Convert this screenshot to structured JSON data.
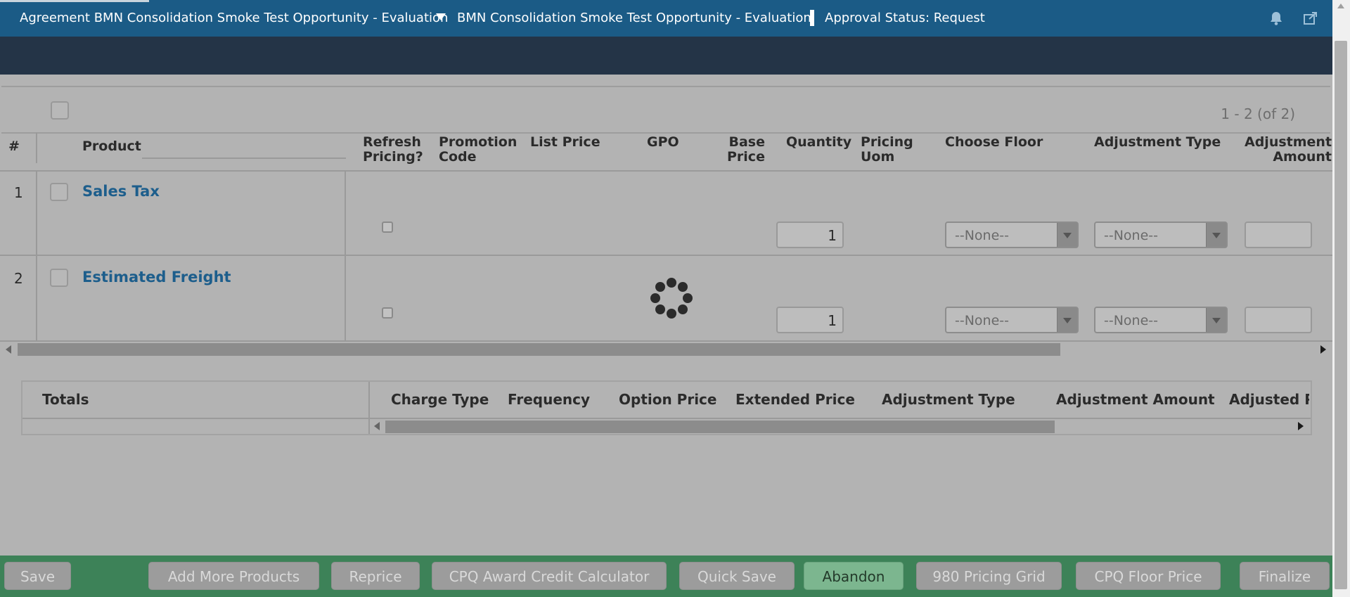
{
  "header": {
    "agreement_crumb": "Agreement BMN Consolidation Smoke Test Opportunity - Evaluation",
    "opportunity_crumb": "BMN Consolidation Smoke Test Opportunity - Evaluation",
    "approval_status": "Approval Status: Request",
    "icons": [
      "bell-icon",
      "share-icon",
      "chevron-down-icon"
    ]
  },
  "grid": {
    "pager": "1 - 2 (of 2)",
    "columns": {
      "num": "#",
      "product": "Product",
      "refresh1": "Refresh",
      "refresh2": "Pricing?",
      "promo1": "Promotion",
      "promo2": "Code",
      "list_price": "List Price",
      "gpo": "GPO",
      "base1": "Base",
      "base2": "Price",
      "quantity": "Quantity",
      "uom1": "Pricing",
      "uom2": "Uom",
      "choose_floor": "Choose Floor",
      "adjustment_type": "Adjustment Type",
      "adjamt1": "Adjustment",
      "adjamt2": "Amount"
    },
    "rows": [
      {
        "num": "1",
        "product": "Sales Tax",
        "quantity": "1",
        "choose_floor": "--None--",
        "adjustment_type": "--None--"
      },
      {
        "num": "2",
        "product": "Estimated Freight",
        "quantity": "1",
        "choose_floor": "--None--",
        "adjustment_type": "--None--"
      }
    ]
  },
  "totals": {
    "label": "Totals",
    "columns": [
      "Charge Type",
      "Frequency",
      "Option Price",
      "Extended Price",
      "Adjustment Type",
      "Adjustment Amount",
      "Adjusted Pri"
    ]
  },
  "actions": {
    "save": "Save",
    "add_more_products": "Add More Products",
    "reprice": "Reprice",
    "cpq_award_credit_calculator": "CPQ Award Credit Calculator",
    "quick_save": "Quick Save",
    "abandon": "Abandon",
    "pricing_grid": "980 Pricing Grid",
    "cpq_floor_price": "CPQ Floor Price",
    "finalize": "Finalize"
  },
  "colors": {
    "header_bg": "#1b5b86",
    "subheader_bg": "#243447",
    "footer_bg": "#3d8258",
    "link": "#1d5e8c",
    "abandon_button": "#7cb68f"
  }
}
